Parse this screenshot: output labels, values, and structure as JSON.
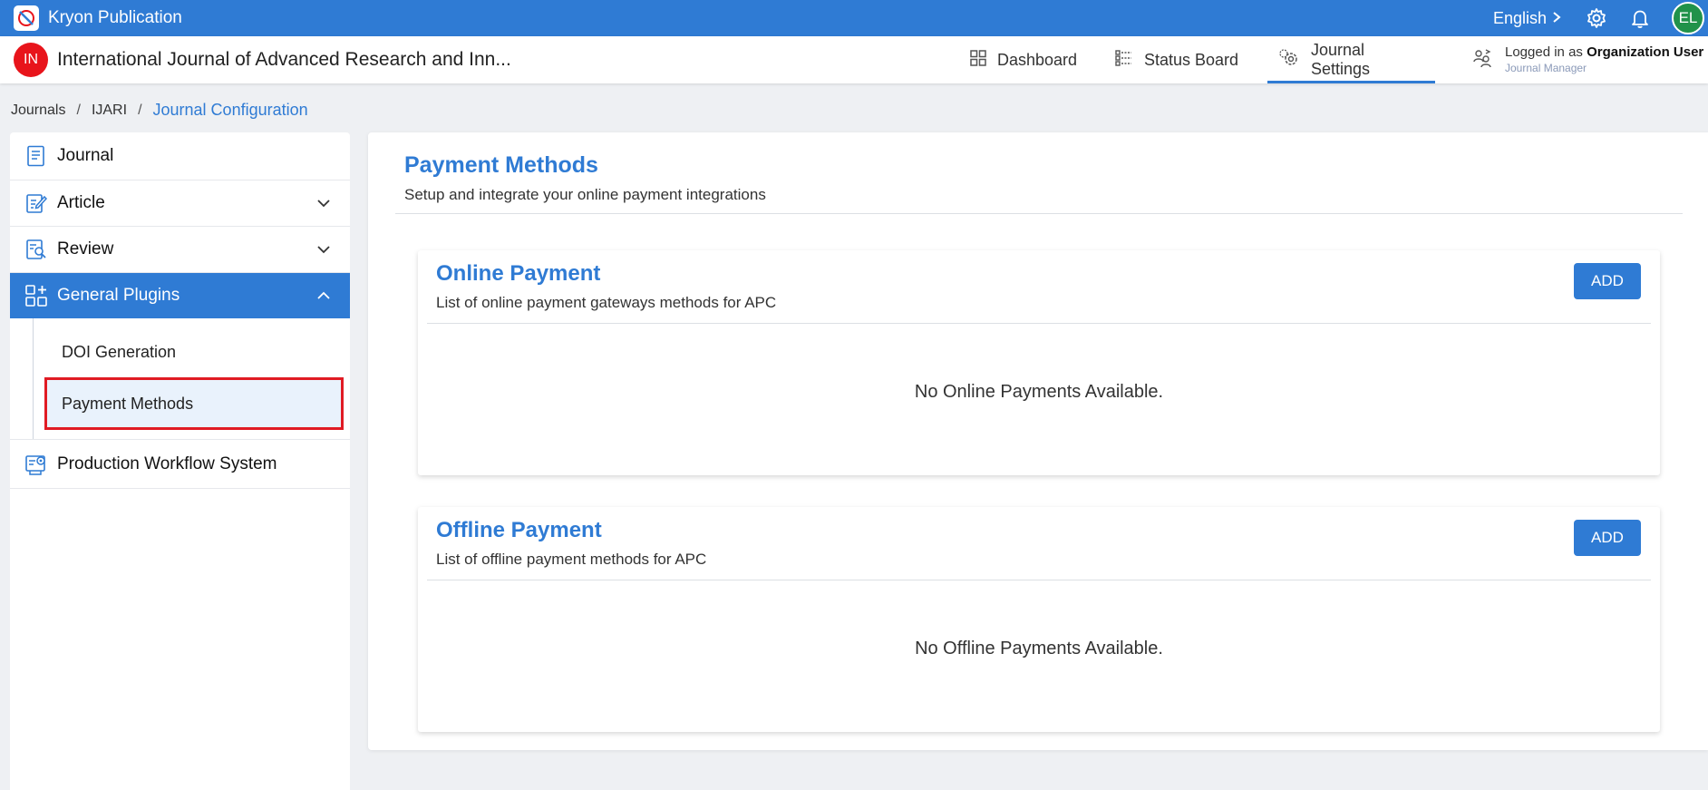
{
  "app": {
    "title": "Kryon Publication"
  },
  "topbar": {
    "language": "English",
    "avatar_initials": "EL"
  },
  "navbar": {
    "journal_badge": "IN",
    "journal_name": "International Journal of Advanced Research and Inn...",
    "tabs": [
      {
        "label": "Dashboard",
        "icon": "grid-icon"
      },
      {
        "label": "Status Board",
        "icon": "status-board-icon"
      },
      {
        "label": "Journal Settings",
        "icon": "gears-icon",
        "active": true
      }
    ],
    "user": {
      "logged_in_prefix": "Logged in as",
      "name": "Organization User",
      "role": "Journal Manager"
    }
  },
  "breadcrumb": {
    "items": [
      "Journals",
      "IJARI"
    ],
    "current": "Journal Configuration",
    "separator": "/"
  },
  "sidebar": {
    "items": [
      {
        "label": "Journal",
        "icon": "document-icon"
      },
      {
        "label": "Article",
        "icon": "edit-document-icon",
        "expandable": true
      },
      {
        "label": "Review",
        "icon": "review-icon",
        "expandable": true
      },
      {
        "label": "General Plugins",
        "icon": "plugins-icon",
        "expandable": true,
        "expanded": true,
        "active": true
      },
      {
        "label": "Production Workflow System",
        "icon": "workflow-icon"
      }
    ],
    "subitems": [
      {
        "label": "DOI Generation"
      },
      {
        "label": "Payment Methods",
        "selected": true
      }
    ]
  },
  "main": {
    "title": "Payment Methods",
    "subtitle": "Setup and integrate your online payment integrations",
    "online": {
      "title": "Online Payment",
      "subtitle": "List of online payment gateways methods for APC",
      "button": "ADD",
      "empty": "No Online Payments Available."
    },
    "offline": {
      "title": "Offline Payment",
      "subtitle": "List of offline payment methods for APC",
      "button": "ADD",
      "empty": "No Offline Payments Available."
    }
  },
  "colors": {
    "primary": "#2f7bd4",
    "badge_red": "#e8141b",
    "avatar_green": "#21924a",
    "highlight_red": "#e01b24"
  }
}
